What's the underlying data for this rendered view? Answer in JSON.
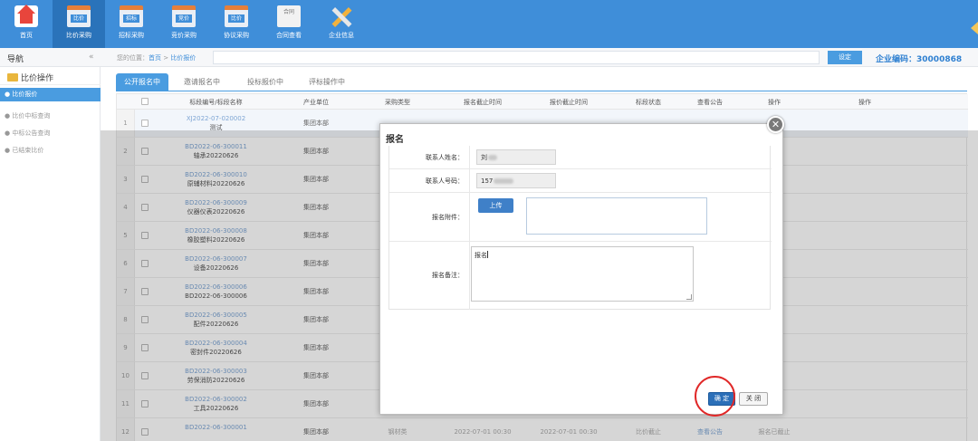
{
  "top_nav": {
    "items": [
      {
        "label": "首页",
        "icon": "home-icon",
        "icon_text": ""
      },
      {
        "label": "比价采购",
        "icon": "price-compare-icon",
        "icon_text": "比价"
      },
      {
        "label": "招标采购",
        "icon": "bidding-icon",
        "icon_text": "招标"
      },
      {
        "label": "竞价采购",
        "icon": "auction-icon",
        "icon_text": "竞价"
      },
      {
        "label": "协议采购",
        "icon": "agreement-icon",
        "icon_text": "比价"
      },
      {
        "label": "合同查看",
        "icon": "contract-icon",
        "icon_text": "合同"
      },
      {
        "label": "企业信息",
        "icon": "tools-icon",
        "icon_text": ""
      }
    ],
    "active_index": 1
  },
  "nav_bar": {
    "title": "导航",
    "collapse_glyph": "«",
    "breadcrumb_prefix": "您的位置：",
    "breadcrumb_home": "首页",
    "breadcrumb_sep": " > ",
    "breadcrumb_current": "比价报价",
    "set_button": "设定",
    "enterprise_code_label": "企业编码：",
    "enterprise_code": "30000868"
  },
  "sidebar": {
    "header": "比价操作",
    "items": [
      {
        "label": "● 比价报价",
        "active": true
      },
      {
        "label": "● 比价中标查询",
        "active": false
      },
      {
        "label": "● 中标公告查询",
        "active": false
      },
      {
        "label": "● 已结束比价",
        "active": false
      }
    ]
  },
  "tabs": [
    "公开报名中",
    "邀请报名中",
    "投标报价中",
    "评标操作中"
  ],
  "table": {
    "columns": [
      "标段编号/标段名称",
      "产业单位",
      "采购类型",
      "报名截止时间",
      "报价截止时间",
      "标段状态",
      "查看公告",
      "操作",
      "操作"
    ],
    "rows": [
      {
        "no": "1",
        "code": "XJ2022-07-020002",
        "name": "测试",
        "unit": "集团本部",
        "type": "",
        "end1": "",
        "end2": "",
        "status": "",
        "notice": "",
        "op": ""
      },
      {
        "no": "2",
        "code": "BD2022-06-300011",
        "name": "轴承20220626",
        "unit": "集团本部",
        "type": "",
        "end1": "",
        "end2": "",
        "status": "",
        "notice": "",
        "op": ""
      },
      {
        "no": "3",
        "code": "BD2022-06-300010",
        "name": "原辅材料20220626",
        "unit": "集团本部",
        "type": "",
        "end1": "",
        "end2": "",
        "status": "",
        "notice": "",
        "op": ""
      },
      {
        "no": "4",
        "code": "BD2022-06-300009",
        "name": "仪器仪表20220626",
        "unit": "集团本部",
        "type": "",
        "end1": "",
        "end2": "",
        "status": "",
        "notice": "",
        "op": ""
      },
      {
        "no": "5",
        "code": "BD2022-06-300008",
        "name": "橡胶塑料20220626",
        "unit": "集团本部",
        "type": "",
        "end1": "",
        "end2": "",
        "status": "",
        "notice": "",
        "op": ""
      },
      {
        "no": "6",
        "code": "BD2022-06-300007",
        "name": "设备20220626",
        "unit": "集团本部",
        "type": "",
        "end1": "",
        "end2": "",
        "status": "",
        "notice": "",
        "op": ""
      },
      {
        "no": "7",
        "code": "BD2022-06-300006",
        "name": "BD2022-06-300006",
        "unit": "集团本部",
        "type": "",
        "end1": "",
        "end2": "",
        "status": "",
        "notice": "",
        "op": ""
      },
      {
        "no": "8",
        "code": "BD2022-06-300005",
        "name": "配件20220626",
        "unit": "集团本部",
        "type": "",
        "end1": "",
        "end2": "",
        "status": "",
        "notice": "",
        "op": ""
      },
      {
        "no": "9",
        "code": "BD2022-06-300004",
        "name": "密封件20220626",
        "unit": "集团本部",
        "type": "",
        "end1": "",
        "end2": "",
        "status": "",
        "notice": "",
        "op": ""
      },
      {
        "no": "10",
        "code": "BD2022-06-300003",
        "name": "劳保消防20220626",
        "unit": "集团本部",
        "type": "",
        "end1": "",
        "end2": "",
        "status": "",
        "notice": "",
        "op": ""
      },
      {
        "no": "11",
        "code": "BD2022-06-300002",
        "name": "工具20220626",
        "unit": "集团本部",
        "type": "",
        "end1": "",
        "end2": "",
        "status": "",
        "notice": "",
        "op": ""
      },
      {
        "no": "12",
        "code": "BD2022-06-300001",
        "name": "",
        "unit": "集团本部",
        "type": "钢材类",
        "end1": "2022-07-01 00:30",
        "end2": "2022-07-01 00:30",
        "status": "比价截止",
        "notice": "查看公告",
        "op": "报名已截止"
      }
    ]
  },
  "dialog": {
    "title": "报名",
    "close_glyph": "✕",
    "contact_name_label": "联系人姓名：",
    "contact_name_value": "刘",
    "contact_phone_label": "联系人号码：",
    "contact_phone_value": "157",
    "attachment_label": "报名附件：",
    "upload_button": "上传",
    "remark_label": "报名备注：",
    "remark_value": "报名",
    "ok_button": "确 定",
    "close_button": "关 闭"
  }
}
